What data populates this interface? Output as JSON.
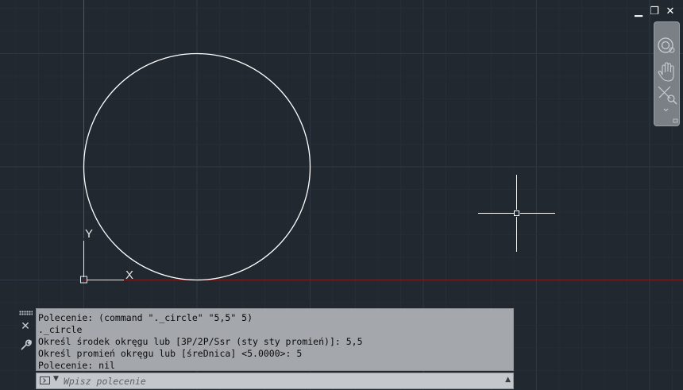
{
  "window_controls": {
    "minimize": "▁",
    "restore": "❐",
    "close": "✕"
  },
  "ucs": {
    "x_label": "X",
    "y_label": "Y"
  },
  "colors": {
    "background": "#212830",
    "grid_minor": "#262d37",
    "grid_major": "#2f3744",
    "circle": "#ffffff",
    "x_axis": "#7a1f22",
    "y_axis": "#1f7a27",
    "command_history_bg": "#a4a8ad"
  },
  "navbar": {
    "tools": [
      {
        "name": "steering-wheel-icon"
      },
      {
        "name": "pan-icon"
      },
      {
        "name": "zoom-extents-icon"
      }
    ]
  },
  "command_side": {
    "close": "✕",
    "customize": "🔧"
  },
  "command_history": [
    "Polecenie: (command \"._circle\" \"5,5\" 5)",
    "._circle",
    "Określ środek okręgu lub [3P/2P/Ssr (sty sty promień)]: 5,5",
    "Określ promień okręgu lub [śreDnica] <5.0000>: 5",
    "Polecenie: nil"
  ],
  "command_input": {
    "placeholder": "Wpisz polecenie",
    "value": ""
  }
}
